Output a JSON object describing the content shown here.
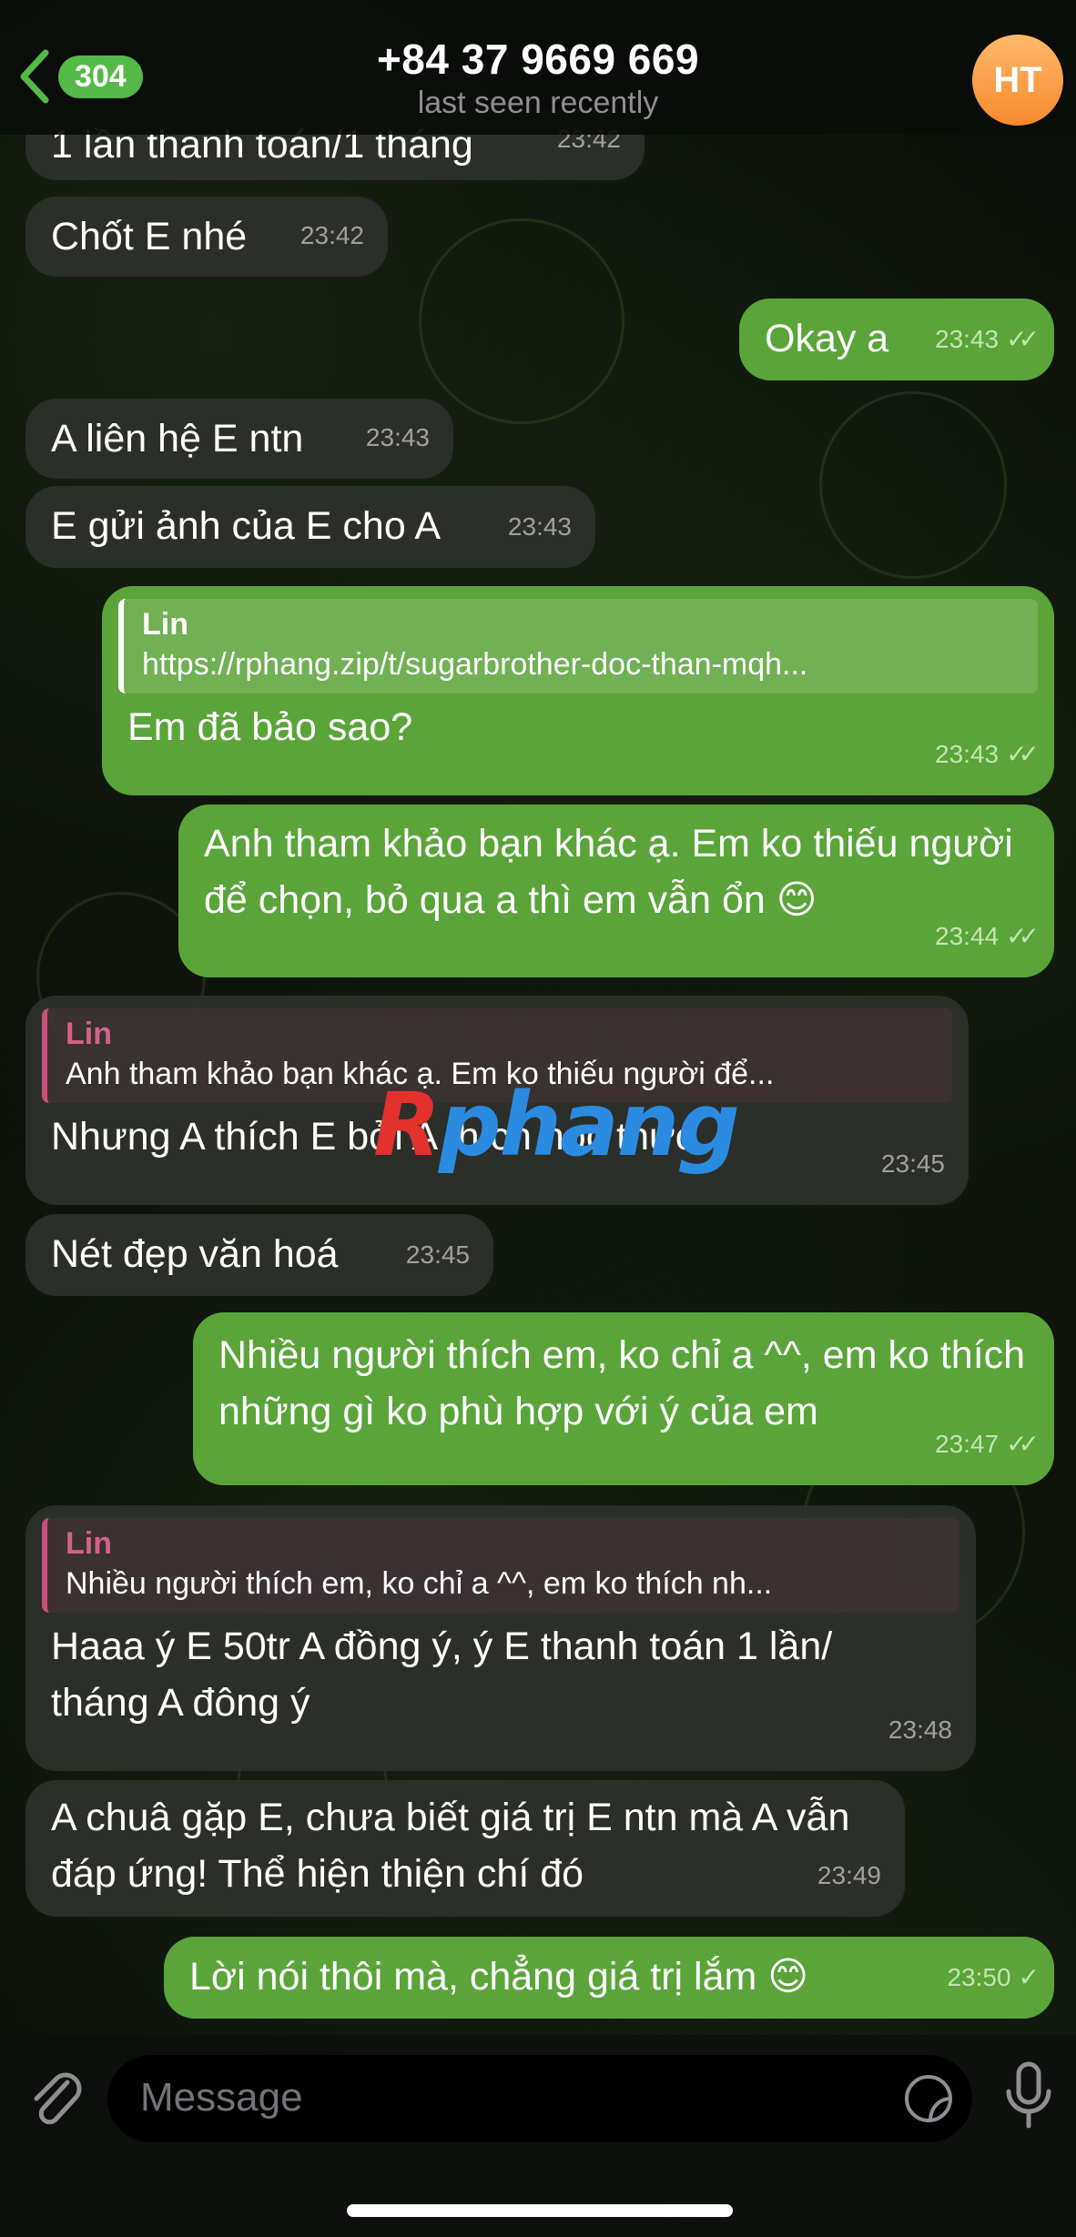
{
  "header": {
    "back_count": "304",
    "title": "+84 37 9669 669",
    "subtitle": "last seen recently",
    "avatar_initials": "HT"
  },
  "messages": [
    {
      "dir": "in",
      "text": "1 lần thanh toán/1 tháng",
      "time": "23:42"
    },
    {
      "dir": "in",
      "text": "Chốt E nhé",
      "time": "23:42"
    },
    {
      "dir": "out",
      "text": "Okay a",
      "time": "23:43"
    },
    {
      "dir": "in",
      "text": "A liên hệ E ntn",
      "time": "23:43"
    },
    {
      "dir": "in",
      "text": "E gửi ảnh của E cho A",
      "time": "23:43"
    },
    {
      "dir": "out",
      "reply_name": "Lin",
      "reply_text": "https://rphang.zip/t/sugarbrother-doc-than-mqh...",
      "text": "Em đã bảo sao?",
      "time": "23:43"
    },
    {
      "dir": "out",
      "text": "Anh tham khảo bạn khác ạ. Em ko thiếu người để chọn, bỏ qua a thì em vẫn ổn 😊",
      "time": "23:44"
    },
    {
      "dir": "in",
      "reply_name": "Lin",
      "reply_text": "Anh tham khảo bạn khác ạ. Em ko thiếu người để...",
      "text": "Nhưng A thích E bởi A thích học thức",
      "time": "23:45"
    },
    {
      "dir": "in",
      "text": "Nét đẹp văn hoá",
      "time": "23:45"
    },
    {
      "dir": "out",
      "text": "Nhiều người thích em, ko chỉ a ^^, em ko thích những gì ko phù hợp với ý của em",
      "time": "23:47"
    },
    {
      "dir": "in",
      "reply_name": "Lin",
      "reply_text": "Nhiều người thích em, ko chỉ a ^^, em ko thích nh...",
      "text": "Haaa ý E 50tr A đồng ý, ý E thanh toán 1 lần/ tháng A đông ý",
      "time": "23:48"
    },
    {
      "dir": "in",
      "text": "A chuâ gặp E, chưa biết giá trị E ntn mà A vẫn đáp ứng! Thể hiện thiện chí đó",
      "time": "23:49"
    },
    {
      "dir": "out",
      "text": "Lời nói thôi mà, chẳng giá trị lắm 😊",
      "time": "23:50"
    }
  ],
  "watermark": {
    "part1": "R",
    "part2": "phang"
  },
  "input": {
    "placeholder": "Message"
  },
  "icons": [
    "back-chevron-icon",
    "attach-icon",
    "sticker-icon",
    "mic-icon",
    "read-ticks-icon"
  ],
  "colors": {
    "outgoing": "#5aa43a",
    "incoming": "#2e302c",
    "accent": "#54b947",
    "reply_name": "#d4628a"
  }
}
